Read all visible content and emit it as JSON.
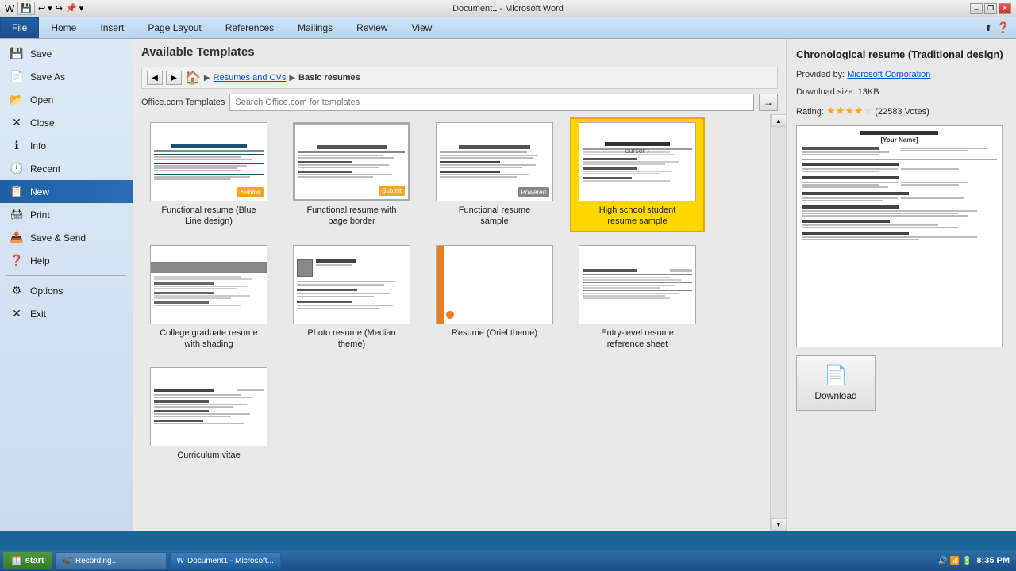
{
  "titleBar": {
    "title": "Document1 - Microsoft Word",
    "minimizeLabel": "–",
    "restoreLabel": "❐",
    "closeLabel": "✕"
  },
  "quickToolbar": {
    "buttons": [
      "💾",
      "↩",
      "↪",
      "📌"
    ]
  },
  "ribbonTabs": [
    {
      "label": "File",
      "active": true
    },
    {
      "label": "Home"
    },
    {
      "label": "Insert"
    },
    {
      "label": "Page Layout"
    },
    {
      "label": "References"
    },
    {
      "label": "Mailings"
    },
    {
      "label": "Review"
    },
    {
      "label": "View"
    }
  ],
  "sidebar": {
    "items": [
      {
        "label": "Save",
        "icon": "💾",
        "active": false
      },
      {
        "label": "Save As",
        "icon": "📄",
        "active": false
      },
      {
        "label": "Open",
        "icon": "📂",
        "active": false
      },
      {
        "label": "Close",
        "icon": "✕",
        "active": false
      },
      {
        "label": "Info",
        "icon": "ℹ",
        "active": false
      },
      {
        "label": "Recent",
        "icon": "🕐",
        "active": false
      },
      {
        "label": "New",
        "icon": "📋",
        "active": true
      },
      {
        "label": "Print",
        "icon": "🖨",
        "active": false
      },
      {
        "label": "Save & Send",
        "icon": "📤",
        "active": false
      },
      {
        "label": "Help",
        "icon": "❓",
        "active": false
      },
      {
        "label": "Options",
        "icon": "⚙",
        "active": false
      },
      {
        "label": "Exit",
        "icon": "🚪",
        "active": false
      }
    ]
  },
  "templates": {
    "headerTitle": "Available Templates",
    "breadcrumb": {
      "backTitle": "Back",
      "forwardTitle": "Forward",
      "homeLabel": "Home",
      "items": [
        "Resumes and CVs",
        "Basic resumes"
      ]
    },
    "search": {
      "label": "Office.com Templates",
      "placeholder": "Search Office.com for templates",
      "buttonLabel": "→"
    },
    "items": [
      {
        "label": "Functional resume (Blue\nLine design)",
        "selected": false
      },
      {
        "label": "Functional resume with\npage border",
        "selected": false
      },
      {
        "label": "Functional resume\nsample",
        "selected": false
      },
      {
        "label": "High school student\nresume sample",
        "selected": true
      },
      {
        "label": "College graduate resume\nwith shading",
        "selected": false
      },
      {
        "label": "Photo resume (Median\ntheme)",
        "selected": false
      },
      {
        "label": "Resume (Oriel theme)",
        "selected": false
      },
      {
        "label": "Entry-level resume\nreference sheet",
        "selected": false
      },
      {
        "label": "Curriculum vitae",
        "selected": false
      }
    ]
  },
  "rightPanel": {
    "title": "Chronological resume (Traditional design)",
    "provider": "Provided by:",
    "providerName": "Microsoft Corporation",
    "downloadSize": "Download size: 13KB",
    "ratingLabel": "Rating:",
    "votes": "(22583 Votes)",
    "downloadLabel": "Download"
  },
  "taskbar": {
    "startLabel": "start",
    "items": [
      {
        "icon": "📹",
        "label": "Recording..."
      },
      {
        "icon": "W",
        "label": "Document1 - Microsoft..."
      }
    ],
    "time": "8:35 PM"
  }
}
